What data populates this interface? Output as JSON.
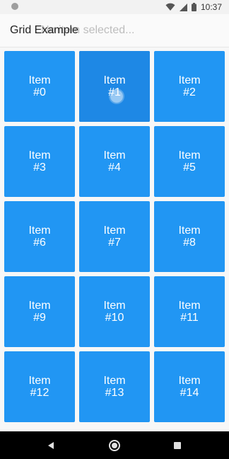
{
  "status_bar": {
    "time": "10:37",
    "icons": [
      "notification-dot-icon",
      "wifi-icon",
      "cell-signal-icon",
      "battery-icon"
    ]
  },
  "app_bar": {
    "title": "Grid Example",
    "subtitle": "No item selected..."
  },
  "grid": {
    "tiles": [
      {
        "line1": "Item",
        "line2": "#0"
      },
      {
        "line1": "Item",
        "line2": "#1"
      },
      {
        "line1": "Item",
        "line2": "#2"
      },
      {
        "line1": "Item",
        "line2": "#3"
      },
      {
        "line1": "Item",
        "line2": "#4"
      },
      {
        "line1": "Item",
        "line2": "#5"
      },
      {
        "line1": "Item",
        "line2": "#6"
      },
      {
        "line1": "Item",
        "line2": "#7"
      },
      {
        "line1": "Item",
        "line2": "#8"
      },
      {
        "line1": "Item",
        "line2": "#9"
      },
      {
        "line1": "Item",
        "line2": "#10"
      },
      {
        "line1": "Item",
        "line2": "#11"
      },
      {
        "line1": "Item",
        "line2": "#12"
      },
      {
        "line1": "Item",
        "line2": "#13"
      },
      {
        "line1": "Item",
        "line2": "#14"
      }
    ],
    "pressed_index": 1
  },
  "nav_bar": {
    "buttons": [
      "back-icon",
      "home-icon",
      "recents-icon"
    ]
  },
  "colors": {
    "tile": "#2196f3",
    "tile_pressed": "#1e88e5",
    "title_text": "#212121",
    "subtitle_text": "#bdbdbd"
  }
}
